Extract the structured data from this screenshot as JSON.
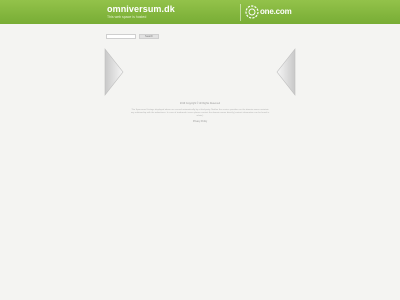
{
  "header": {
    "site_title": "omniversum.dk",
    "site_subtitle": "This web space is hosted",
    "brand_name": "one.com",
    "background_color": "#86b83f"
  },
  "search": {
    "input_value": "",
    "button_label": "Search"
  },
  "nav": {
    "prev_icon": "chevron-left-icon",
    "next_icon": "chevron-right-icon"
  },
  "footer": {
    "copyright": "2019 Copyright © All Rights Reserved",
    "disclaimer": "The Sponsored Listings displayed above are served automatically by a third party. Neither the service provider nor the domain owner maintain any relationship with the advertisers. In case of trademark issues please contact the domain owner directly (contact information can be found in whois).",
    "privacy_label": "Privacy Policy"
  }
}
